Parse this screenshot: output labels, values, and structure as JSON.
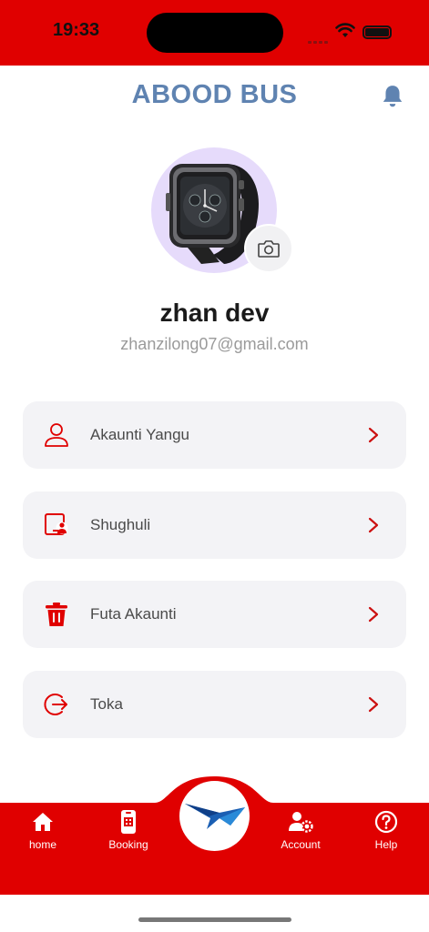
{
  "status_bar": {
    "time": "19:33",
    "battery_icon": "battery-icon",
    "wifi_icon": "wifi-icon"
  },
  "header": {
    "title": "ABOOD BUS",
    "notification_icon": "bell-icon"
  },
  "profile": {
    "name": "zhan dev",
    "email": "zhanzilong07@gmail.com",
    "avatar_icon": "smartwatch-photo",
    "camera_icon": "camera-icon"
  },
  "menu": [
    {
      "label": "Akaunti Yangu",
      "icon": "user-icon"
    },
    {
      "label": "Shughuli",
      "icon": "activity-icon"
    },
    {
      "label": "Futa Akaunti",
      "icon": "trash-icon"
    },
    {
      "label": "Toka",
      "icon": "logout-icon"
    }
  ],
  "bottom_nav": [
    {
      "label": "home",
      "icon": "home-icon"
    },
    {
      "label": "Booking",
      "icon": "ticket-icon"
    },
    {
      "label": "Account",
      "icon": "user-settings-icon"
    },
    {
      "label": "Help",
      "icon": "help-icon"
    }
  ],
  "colors": {
    "primary": "#e00000",
    "title": "#5f83b1",
    "card": "#f3f3f6",
    "avatar_bg": "#e6dbfb"
  }
}
